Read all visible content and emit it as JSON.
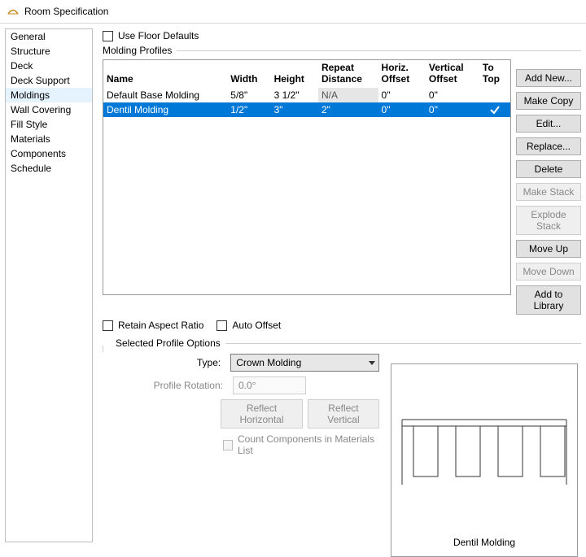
{
  "window": {
    "title": "Room Specification"
  },
  "sidebar": {
    "items": [
      {
        "label": "General"
      },
      {
        "label": "Structure"
      },
      {
        "label": "Deck"
      },
      {
        "label": "Deck Support"
      },
      {
        "label": "Moldings"
      },
      {
        "label": "Wall Covering"
      },
      {
        "label": "Fill Style"
      },
      {
        "label": "Materials"
      },
      {
        "label": "Components"
      },
      {
        "label": "Schedule"
      }
    ],
    "selected_index": 4
  },
  "checkboxes": {
    "use_floor_defaults": "Use Floor Defaults",
    "retain_aspect": "Retain Aspect Ratio",
    "auto_offset": "Auto Offset",
    "count_components": "Count Components in Materials List"
  },
  "sections": {
    "profiles": "Molding Profiles",
    "selected_profile": "Selected Profile Options"
  },
  "table": {
    "headers": {
      "name": "Name",
      "width": "Width",
      "height": "Height",
      "repeat": "Repeat Distance",
      "horiz": "Horiz. Offset",
      "vert": "Vertical Offset",
      "totop": "To Top"
    },
    "rows": [
      {
        "name": "Default Base Molding",
        "width": "5/8\"",
        "height": "3 1/2\"",
        "repeat": "N/A",
        "horiz": "0\"",
        "vert": "0\"",
        "totop": false
      },
      {
        "name": "Dentil Molding",
        "width": "1/2\"",
        "height": "3\"",
        "repeat": "2\"",
        "horiz": "0\"",
        "vert": "0\"",
        "totop": true
      }
    ],
    "selected_index": 1
  },
  "buttons": {
    "add_new": "Add New...",
    "make_copy": "Make Copy",
    "edit": "Edit...",
    "replace": "Replace...",
    "delete": "Delete",
    "make_stack": "Make Stack",
    "explode_stack": "Explode Stack",
    "move_up": "Move Up",
    "move_down": "Move Down",
    "add_library": "Add to Library"
  },
  "selected_profile": {
    "type_label": "Type:",
    "type_value": "Crown Molding",
    "rotation_label": "Profile Rotation:",
    "rotation_value": "0.0°",
    "reflect_h": "Reflect Horizontal",
    "reflect_v": "Reflect Vertical"
  },
  "preview": {
    "caption": "Dentil Molding"
  }
}
